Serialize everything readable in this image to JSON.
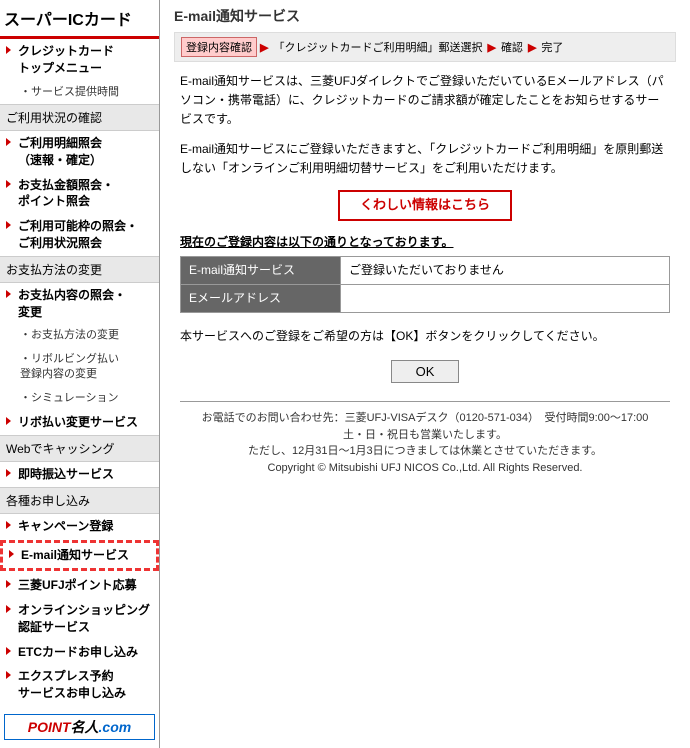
{
  "sidebar": {
    "title": "スーパーICカード",
    "items": [
      {
        "label": "クレジットカード\nトップメニュー",
        "bold": true
      },
      {
        "label": "・サービス提供時間",
        "sub": true
      }
    ],
    "section1": {
      "header": "ご利用状況の確認",
      "items": [
        {
          "label": "ご利用明細照会\n（速報・確定）",
          "bold": true
        },
        {
          "label": "お支払金額照会・\nポイント照会",
          "bold": true
        },
        {
          "label": "ご利用可能枠の照会・\nご利用状況照会",
          "bold": true
        }
      ]
    },
    "section2": {
      "header": "お支払方法の変更",
      "items": [
        {
          "label": "お支払内容の照会・\n変更",
          "bold": true
        },
        {
          "label": "・お支払方法の変更",
          "sub": true
        },
        {
          "label": "・リボルビング払い\n登録内容の変更",
          "sub": true
        },
        {
          "label": "・シミュレーション",
          "sub": true
        },
        {
          "label": "リボ払い変更サービス",
          "bold": true
        }
      ]
    },
    "section3": {
      "header": "Webでキャッシング",
      "items": [
        {
          "label": "即時振込サービス",
          "bold": true
        }
      ]
    },
    "section4": {
      "header": "各種お申し込み",
      "items": [
        {
          "label": "キャンペーン登録",
          "bold": true
        },
        {
          "label": "E-mail通知サービス",
          "bold": true,
          "highlight": true
        },
        {
          "label": "三菱UFJポイント応募",
          "bold": true
        },
        {
          "label": "オンラインショッピング\n認証サービス",
          "bold": true
        },
        {
          "label": "ETCカードお申し込み",
          "bold": true
        },
        {
          "label": "エクスプレス予約\nサービスお申し込み",
          "bold": true
        }
      ]
    },
    "banner": {
      "text1": "POINT",
      "text2": "名人",
      "text3": ".com"
    }
  },
  "main": {
    "title": "E-mail通知サービス",
    "breadcrumb": [
      {
        "label": "登録内容確認",
        "current": true
      },
      {
        "label": "「クレジットカードご利用明細」郵送選択"
      },
      {
        "label": "確認"
      },
      {
        "label": "完了"
      }
    ],
    "para1": "E-mail通知サービスは、三菱UFJダイレクトでご登録いただいているEメールアドレス（パソコン・携帯電話）に、クレジットカードのご請求額が確定したことをお知らせするサービスです。",
    "para2": "E-mail通知サービスにご登録いただきますと、「クレジットカードご利用明細」を原則郵送しない「オンラインご利用明細切替サービス」をご利用いただけます。",
    "info_btn": "くわしい情報はこちら",
    "table_label": "現在のご登録内容は以下の通りとなっております。",
    "rows": [
      {
        "hdr": "E-mail通知サービス",
        "val": "ご登録いただいておりません"
      },
      {
        "hdr": "Eメールアドレス",
        "val": ""
      }
    ],
    "para3": "本サービスへのご登録をご希望の方は【OK】ボタンをクリックしてください。",
    "ok": "OK",
    "footer": {
      "line1": "お電話でのお問い合わせ先：三菱UFJ-VISAデスク（0120-571-034）　受付時間9:00～17:00",
      "line2": "土・日・祝日も営業いたします。",
      "line3": "ただし、12月31日～1月3日につきましては休業とさせていただきます。",
      "line4": "Copyright © Mitsubishi UFJ NICOS Co.,Ltd. All Rights Reserved."
    }
  }
}
